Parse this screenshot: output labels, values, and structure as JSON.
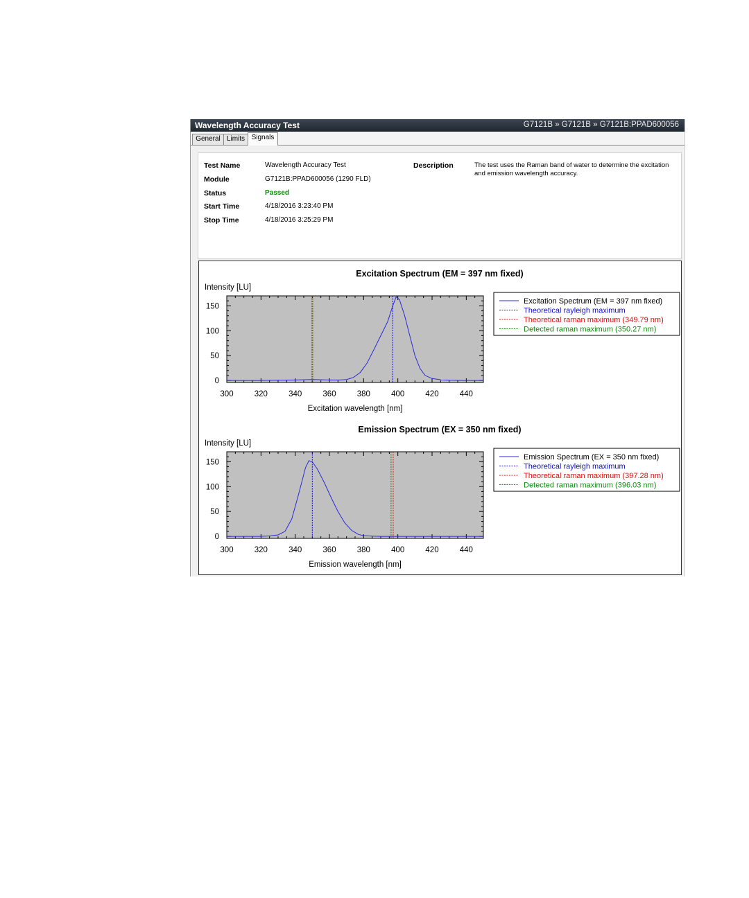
{
  "window": {
    "title": "Wavelength Accuracy Test",
    "breadcrumb": "G7121B » G7121B » G7121B:PPAD600056"
  },
  "tabs": [
    {
      "label": "General"
    },
    {
      "label": "Limits"
    },
    {
      "label": "Signals"
    }
  ],
  "info": {
    "test_name_label": "Test Name",
    "test_name": "Wavelength Accuracy Test",
    "module_label": "Module",
    "module": "G7121B:PPAD600056 (1290 FLD)",
    "status_label": "Status",
    "status": "Passed",
    "start_label": "Start Time",
    "start": "4/18/2016 3:23:40 PM",
    "stop_label": "Stop Time",
    "stop": "4/18/2016 3:25:29 PM",
    "description_label": "Description",
    "description": "The test uses the Raman band of water to determine the excitation and emission wavelength accuracy."
  },
  "colors": {
    "plot_bg": "#c0c0c0",
    "spectrum": "#2a2ad6",
    "rayleigh": "#1010c0",
    "raman_theoretical": "#e01010",
    "raman_detected": "#108a10",
    "passed": "#0a8a0a"
  },
  "chart_data": [
    {
      "type": "line",
      "title": "Excitation Spectrum (EM = 397 nm fixed)",
      "xlabel": "Excitation wavelength [nm]",
      "ylabel": "Intensity [LU]",
      "xlim": [
        300,
        450
      ],
      "ylim": [
        -4,
        170
      ],
      "xticks": [
        300,
        320,
        340,
        360,
        380,
        400,
        420,
        440
      ],
      "yticks": [
        0,
        50,
        100,
        150
      ],
      "grid": false,
      "legend_position": "right",
      "series": [
        {
          "name": "Excitation Spectrum (EM = 397 nm fixed)",
          "kind": "curve",
          "x": [
            300,
            320,
            340,
            350,
            360,
            366,
            370,
            374,
            378,
            382,
            386,
            390,
            394,
            397,
            399,
            401,
            404,
            407,
            410,
            413,
            416,
            420,
            425,
            430,
            440,
            450
          ],
          "y": [
            0,
            0,
            1,
            2,
            1,
            1,
            2,
            6,
            16,
            35,
            62,
            90,
            118,
            150,
            168,
            162,
            130,
            90,
            50,
            24,
            10,
            4,
            1.5,
            0.5,
            0,
            0
          ]
        },
        {
          "name": "Theoretical rayleigh maximum",
          "kind": "vline",
          "value": 397,
          "color_key": "rayleigh"
        },
        {
          "name": "Theoretical raman maximum (349.79 nm)",
          "kind": "vline",
          "value": 349.79,
          "color_key": "raman_theoretical"
        },
        {
          "name": "Detected raman maximum (350.27 nm)",
          "kind": "vline",
          "value": 350.27,
          "color_key": "raman_detected"
        }
      ]
    },
    {
      "type": "line",
      "title": "Emission Spectrum (EX = 350 nm fixed)",
      "xlabel": "Emission wavelength [nm]",
      "ylabel": "Intensity [LU]",
      "xlim": [
        300,
        450
      ],
      "ylim": [
        -4,
        170
      ],
      "xticks": [
        300,
        320,
        340,
        360,
        380,
        400,
        420,
        440
      ],
      "yticks": [
        0,
        50,
        100,
        150
      ],
      "grid": false,
      "legend_position": "right",
      "series": [
        {
          "name": "Emission Spectrum (EX = 350 nm fixed)",
          "kind": "curve",
          "x": [
            300,
            320,
            325,
            330,
            334,
            338,
            342,
            346,
            348,
            350,
            353,
            357,
            361,
            365,
            369,
            373,
            377,
            380,
            385,
            390,
            400,
            450
          ],
          "y": [
            0,
            0,
            1,
            3,
            10,
            35,
            85,
            138,
            152,
            150,
            135,
            108,
            78,
            50,
            27,
            12,
            4,
            1.5,
            0.5,
            0,
            0,
            0
          ]
        },
        {
          "name": "Theoretical rayleigh maximum",
          "kind": "vline",
          "value": 350,
          "color_key": "rayleigh"
        },
        {
          "name": "Theoretical raman maximum (397.28 nm)",
          "kind": "vline",
          "value": 397.28,
          "color_key": "raman_theoretical"
        },
        {
          "name": "Detected raman maximum (396.03 nm)",
          "kind": "vline",
          "value": 396.03,
          "color_key": "raman_detected"
        }
      ]
    }
  ]
}
